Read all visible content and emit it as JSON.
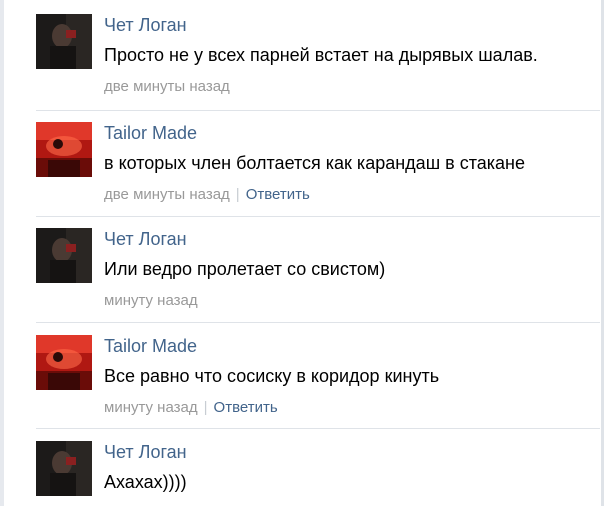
{
  "comments": [
    {
      "author": "Чет Логан",
      "avatar_icon": "person-dark-photo-icon",
      "text": "Просто не у всех парней встает на дырявых шалав.",
      "time": "две минуты назад",
      "reply": ""
    },
    {
      "author": "Tailor Made",
      "avatar_icon": "red-flag-crowd-photo-icon",
      "text": "в которых член болтается как карандаш в стакане",
      "time": "две минуты назад",
      "reply": "Ответить"
    },
    {
      "author": "Чет Логан",
      "avatar_icon": "person-dark-photo-icon",
      "text": "Или ведро пролетает со свистом)",
      "time": "минуту назад",
      "reply": ""
    },
    {
      "author": "Tailor Made",
      "avatar_icon": "red-flag-crowd-photo-icon",
      "text": "Все равно что сосиску в коридор кинуть",
      "time": "минуту назад",
      "reply": "Ответить"
    },
    {
      "author": "Чет Логан",
      "avatar_icon": "person-dark-photo-icon",
      "text": "Ахахах))))",
      "time": "",
      "reply": ""
    }
  ],
  "meta_separator": "|",
  "colors": {
    "link": "#42648b",
    "meta": "#999999",
    "divider": "#dfe3e8"
  }
}
